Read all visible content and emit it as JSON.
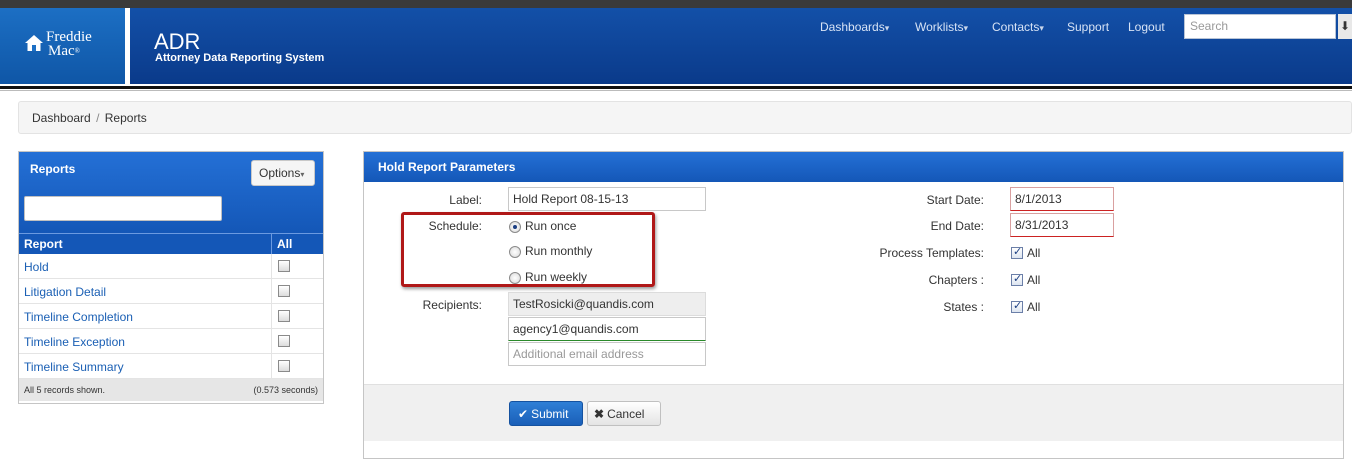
{
  "header": {
    "logo_text_line1": "Freddie",
    "logo_text_line2": "Mac",
    "logo_reg": "®",
    "app_title": "ADR",
    "app_subtitle": "Attorney Data Reporting System",
    "nav": [
      {
        "label": "Dashboards",
        "caret": "▾"
      },
      {
        "label": "Worklists",
        "caret": "▾"
      },
      {
        "label": "Contacts",
        "caret": "▾"
      },
      {
        "label": "Support",
        "caret": ""
      },
      {
        "label": "Logout",
        "caret": ""
      }
    ],
    "search_placeholder": "Search",
    "search_button": "⬇"
  },
  "breadcrumb": {
    "items": [
      "Dashboard",
      "Reports"
    ],
    "separator": "/"
  },
  "reports_panel": {
    "title": "Reports",
    "options_label": "Options",
    "options_caret": "▾",
    "filter_value": "",
    "col_report": "Report",
    "col_all": "All",
    "rows": [
      {
        "name": "Hold"
      },
      {
        "name": "Litigation Detail"
      },
      {
        "name": "Timeline Completion"
      },
      {
        "name": "Timeline Exception"
      },
      {
        "name": "Timeline Summary"
      }
    ],
    "footer_left": "All 5 records shown.",
    "footer_right": "(0.573 seconds)"
  },
  "params_panel": {
    "title": "Hold Report Parameters",
    "label_label": "Label:",
    "label_value": "Hold Report 08-15-13",
    "schedule_label": "Schedule:",
    "schedule_options": [
      {
        "label": "Run once",
        "selected": true
      },
      {
        "label": "Run monthly",
        "selected": false
      },
      {
        "label": "Run weekly",
        "selected": false
      }
    ],
    "recipients_label": "Recipients:",
    "recipients": [
      "TestRosicki@quandis.com",
      "agency1@quandis.com"
    ],
    "recipient_placeholder": "Additional email address",
    "start_date_label": "Start Date:",
    "start_date_value": "8/1/2013",
    "end_date_label": "End Date:",
    "end_date_value": "8/31/2013",
    "process_templates_label": "Process Templates:",
    "chapters_label": "Chapters :",
    "states_label": "States :",
    "all_label": "All",
    "submit_label": "Submit",
    "cancel_label": "Cancel"
  },
  "colors": {
    "header_blue": "#0b3d91",
    "panel_blue": "#1a62c7",
    "link_blue": "#1a5fb4",
    "highlight_red": "#b01818"
  }
}
